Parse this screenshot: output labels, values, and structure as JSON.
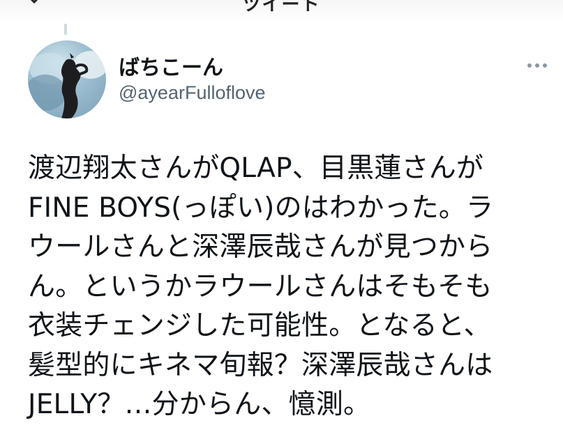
{
  "header": {
    "title": "ツイート"
  },
  "tweet": {
    "display_name": "ばちこーん",
    "handle": "@ayearFulloflove",
    "text": "渡辺翔太さんがQLAP、目黒蓮さんが\nFINE BOYS(っぽい)のはわかった。ラ\nウールさんと深澤辰哉さんが見つから\nん。というかラウールさんはそもそも\n衣装チェンジした可能性。となると、\n髪型的にキネマ旬報？深澤辰哉さんは\nJELLY？…分からん、憶測。"
  },
  "icons": {
    "back": "back-arrow-icon",
    "more": "more-horizontal-icon",
    "avatar": "avatar-image"
  },
  "colors": {
    "text_primary": "#0f1419",
    "text_secondary": "#536471",
    "thread_line": "#cfd9de",
    "background": "#ffffff"
  }
}
